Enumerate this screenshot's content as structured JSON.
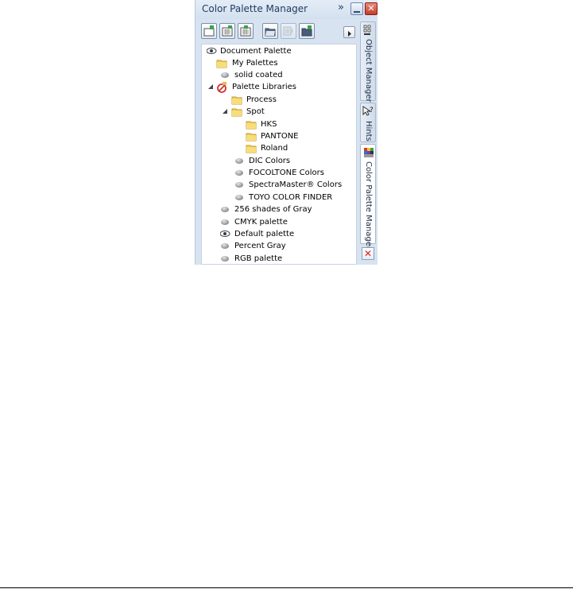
{
  "window": {
    "title": "Color Palette Manager",
    "collapse_glyph": "»",
    "close_glyph": "✕"
  },
  "toolbar": {
    "tools": [
      {
        "icon": "new-palette-icon"
      },
      {
        "icon": "new-palette-from-selection-icon"
      },
      {
        "icon": "new-palette-from-document-icon"
      },
      {
        "icon": "open-palette-icon"
      },
      {
        "icon": "edit-palette-icon"
      },
      {
        "icon": "palette-folder-icon"
      }
    ],
    "more_icon": "flyout-arrow-icon"
  },
  "tree": {
    "nodes": [
      {
        "label": "Document Palette",
        "icon": "eye-icon"
      },
      {
        "label": "My Palettes",
        "icon": "folder-icon",
        "expander": "closed"
      },
      {
        "label": "solid coated",
        "icon": "palette-icon"
      },
      {
        "label": "Palette Libraries",
        "icon": "palette-library-icon",
        "expander": "open"
      },
      {
        "label": "Process",
        "icon": "folder-icon",
        "expander": "closed"
      },
      {
        "label": "Spot",
        "icon": "folder-icon",
        "expander": "open"
      },
      {
        "label": "HKS",
        "icon": "folder-icon",
        "expander": "closed"
      },
      {
        "label": "PANTONE",
        "icon": "folder-icon",
        "expander": "closed"
      },
      {
        "label": "Roland",
        "icon": "folder-icon",
        "expander": "closed"
      },
      {
        "label": "DIC Colors",
        "icon": "palette-icon"
      },
      {
        "label": "FOCOLTONE Colors",
        "icon": "palette-icon"
      },
      {
        "label": "SpectraMaster® Colors",
        "icon": "palette-icon"
      },
      {
        "label": "TOYO COLOR FINDER",
        "icon": "palette-icon"
      },
      {
        "label": "256 shades of Gray",
        "icon": "palette-icon"
      },
      {
        "label": "CMYK palette",
        "icon": "palette-icon"
      },
      {
        "label": "Default palette",
        "icon": "eye-icon"
      },
      {
        "label": "Percent Gray",
        "icon": "palette-icon"
      },
      {
        "label": "RGB palette",
        "icon": "palette-icon"
      }
    ]
  },
  "side_tabs": [
    {
      "label": "Object Manager",
      "icon": "object-manager-icon"
    },
    {
      "label": "Hints",
      "icon": "hints-icon"
    },
    {
      "label": "Color Palette Manager",
      "icon": "color-palette-manager-icon"
    }
  ],
  "docker_close_glyph": "✕",
  "colors": {
    "panel_bg": "#d7e3f1",
    "title_text": "#1f3a5f",
    "close_red": "#c33e29",
    "folder_yellow": "#f3cf5c"
  }
}
